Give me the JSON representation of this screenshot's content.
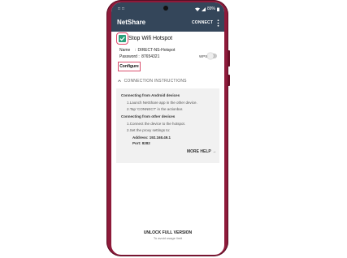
{
  "status_bar": {
    "time": "□ □",
    "battery": "89%"
  },
  "app_bar": {
    "title": "NetShare",
    "connect_label": "CONNECT"
  },
  "hotspot": {
    "checked": true,
    "label": "Stop Wifi Hotspot"
  },
  "network": {
    "name_label": "Name",
    "name_value": "DIRECT-NS-Hotspot",
    "password_label": "Password",
    "password_value": "87654321",
    "wps_label": "WPS",
    "wps_enabled": false
  },
  "configure_label": "Configure",
  "instructions": {
    "header": "CONNECTION INSTRUCTIONS",
    "android_title": "Connecting from Android devices",
    "android_step1": "1.Launch NetShare app in the other device.",
    "android_step2": "2.Tap 'CONNECT' in the actionbar.",
    "other_title": "Connecting from other devices",
    "other_step1": "1.Connect the device to the hotspot.",
    "other_step2": "2.Set the proxy settings to:",
    "address": "Address: 192.168.49.1",
    "port": "Port: 8282"
  },
  "more_help_label": "MORE HELP →",
  "unlock": {
    "title": "UNLOCK FULL VERSION",
    "subtitle": "To avoid usage limit"
  },
  "colors": {
    "toolbar": "#34465a",
    "phone_body": "#8e1a3a",
    "checkbox": "#2ba07a",
    "highlight": "#e0466a"
  }
}
